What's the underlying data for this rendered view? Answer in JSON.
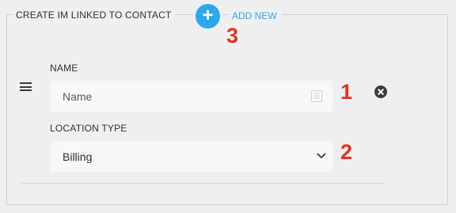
{
  "section": {
    "title": "CREATE IM LINKED TO CONTACT",
    "add_button_icon": "plus-icon",
    "add_label": "ADD NEW"
  },
  "markers": {
    "one": "1",
    "two": "2",
    "three": "3"
  },
  "row": {
    "drag_icon": "drag-handle-icon",
    "name_label": "NAME",
    "name_placeholder": "Name",
    "name_value": "",
    "name_field_icon": "list-icon",
    "location_label": "LOCATION TYPE",
    "location_value": "Billing",
    "remove_icon": "close-circle-icon"
  },
  "colors": {
    "accent": "#2ea6ea",
    "marker": "#e8311e",
    "background": "#efeff1",
    "input_bg": "#f8f8f9",
    "text": "#2d2d2d"
  }
}
